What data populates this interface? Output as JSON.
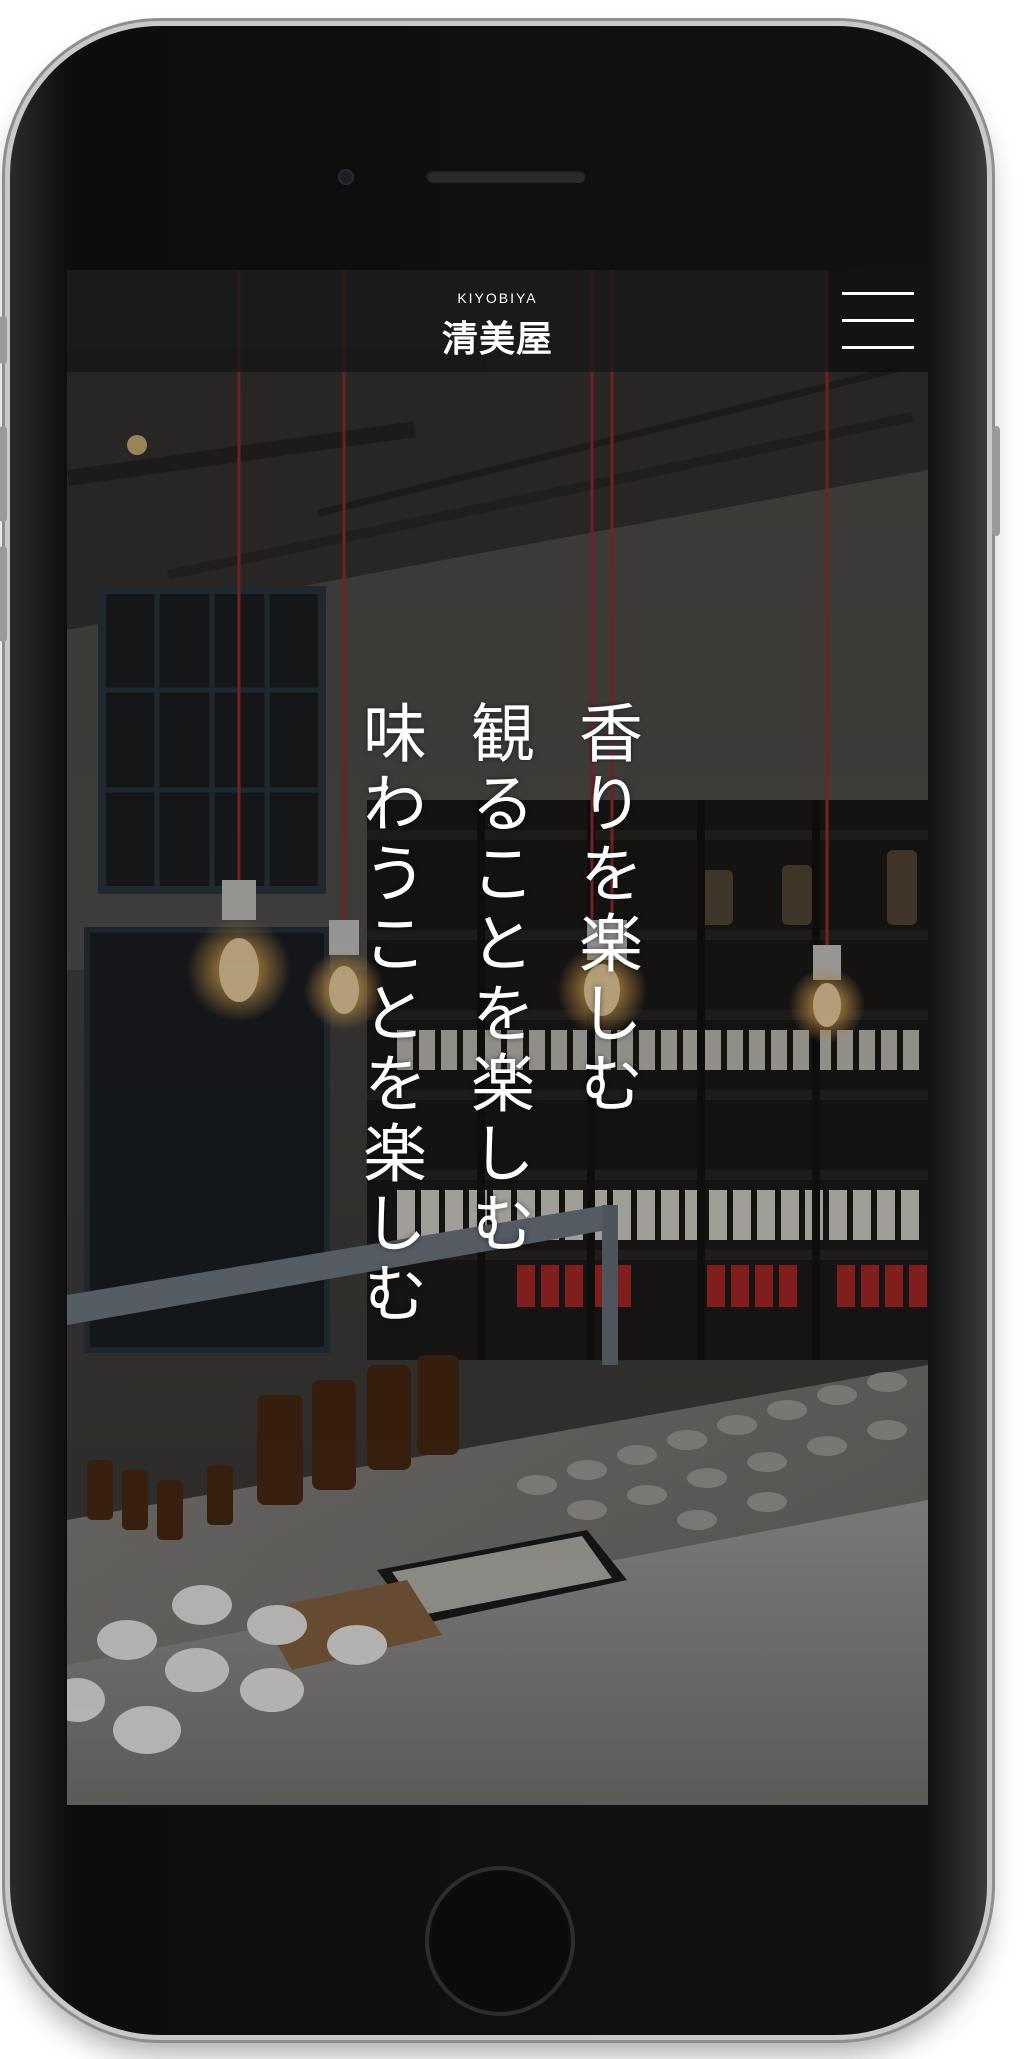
{
  "header": {
    "logo_sub": "KIYOBIYA",
    "logo_main": "清美屋"
  },
  "hero": {
    "tagline": [
      "香りを楽しむ",
      "観ることを楽しむ",
      "味わうことを楽しむ"
    ]
  },
  "icons": {
    "menu": "hamburger-menu-icon"
  },
  "colors": {
    "header_bg": "#161616",
    "text": "#ffffff",
    "cord_red": "#a83232"
  }
}
